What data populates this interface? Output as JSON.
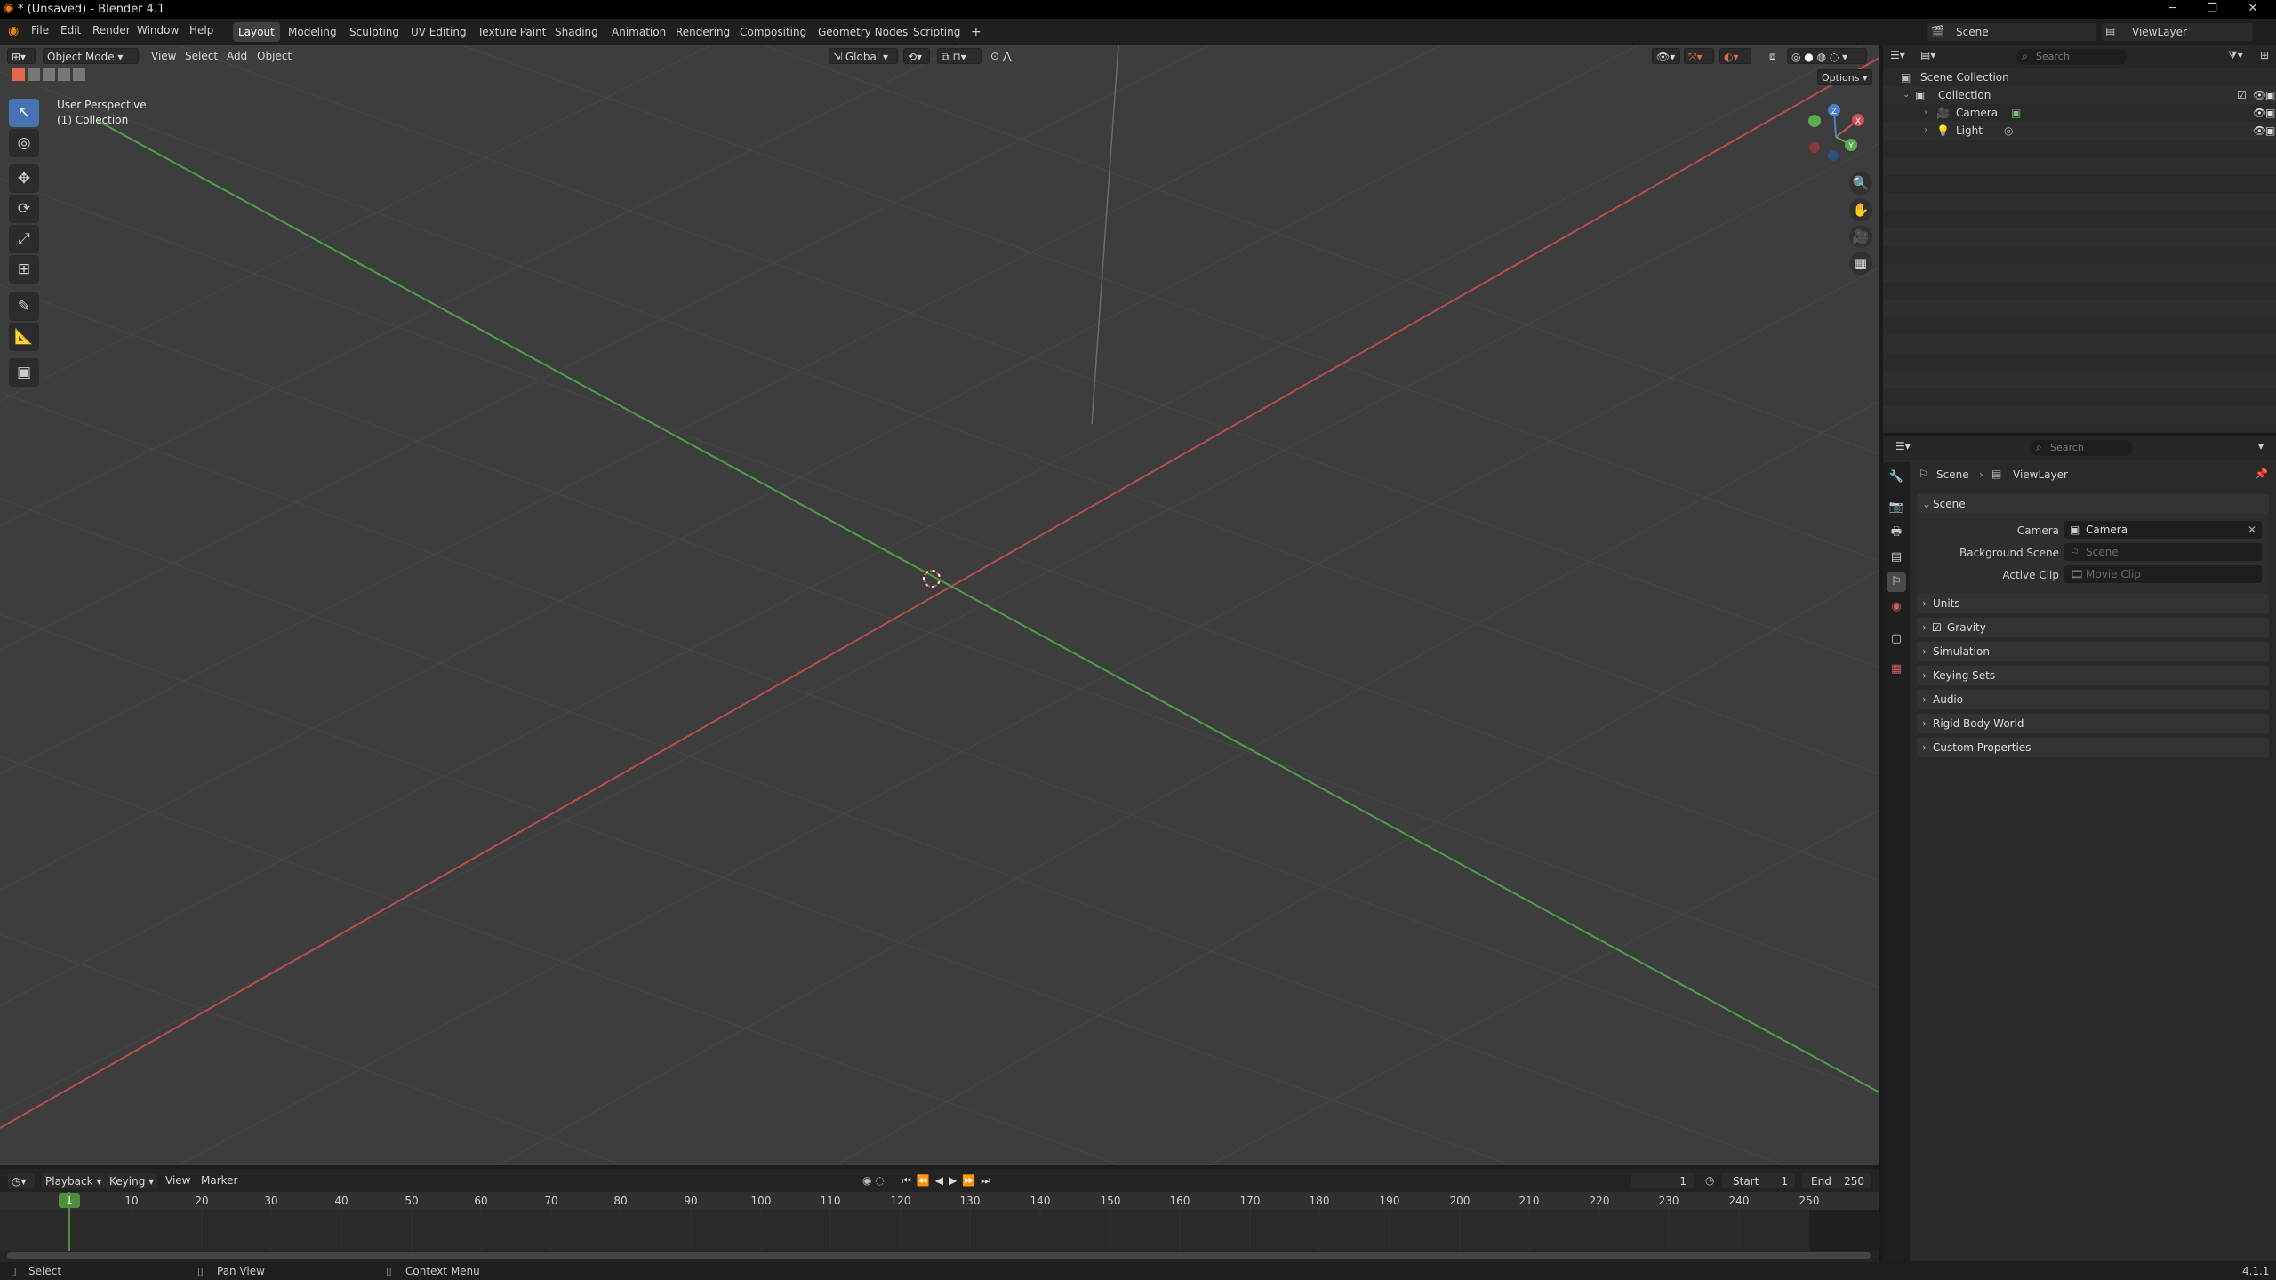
{
  "window": {
    "title": "* (Unsaved) - Blender 4.1",
    "minimize_glyph": "─",
    "maximize_glyph": "❐",
    "close_glyph": "✕"
  },
  "menu": [
    "File",
    "Edit",
    "Render",
    "Window",
    "Help"
  ],
  "workspaces": [
    "Layout",
    "Modeling",
    "Sculpting",
    "UV Editing",
    "Texture Paint",
    "Shading",
    "Animation",
    "Rendering",
    "Compositing",
    "Geometry Nodes",
    "Scripting"
  ],
  "active_workspace": "Layout",
  "add_workspace_glyph": "+",
  "scene_selector": {
    "scene": "Scene",
    "view_layer": "ViewLayer"
  },
  "viewport": {
    "mode": "Object Mode",
    "menus": [
      "View",
      "Select",
      "Add",
      "Object"
    ],
    "orientation": "Global",
    "options_label": "Options",
    "overlay_line1": "User Perspective",
    "overlay_line2": "(1) Collection",
    "tools": [
      "select-box",
      "cursor",
      "move",
      "rotate",
      "scale",
      "transform",
      "annotate",
      "measure",
      "add-cube"
    ],
    "active_tool": "select-box",
    "tool_glyphs": [
      "↖",
      "◎",
      "✥",
      "⟳",
      "⤢",
      "⊞",
      "✎",
      "📐",
      "▣"
    ],
    "nav_glyphs": [
      "🔍",
      "✋",
      "🎥",
      "▦"
    ],
    "gizmo": {
      "x": "X",
      "y": "Y",
      "z": "Z"
    },
    "colors": {
      "x_axis": "#b84d4d",
      "y_axis": "#4f9e4a",
      "grid": "#474747",
      "background": "#3d3d3d"
    }
  },
  "outliner": {
    "search_placeholder": "Search",
    "scene_collection": "Scene Collection",
    "collection": "Collection",
    "items": [
      {
        "name": "Camera",
        "type": "camera"
      },
      {
        "name": "Light",
        "type": "light"
      }
    ]
  },
  "properties": {
    "search_placeholder": "Search",
    "breadcrumb": [
      "Scene",
      "ViewLayer"
    ],
    "panel_title": "Scene",
    "fields": [
      {
        "label": "Camera",
        "value": "Camera",
        "dim": false
      },
      {
        "label": "Background Scene",
        "value": "Scene",
        "dim": true
      },
      {
        "label": "Active Clip",
        "value": "Movie Clip",
        "dim": true
      }
    ],
    "sections": [
      "Units",
      "Gravity",
      "Simulation",
      "Keying Sets",
      "Audio",
      "Rigid Body World",
      "Custom Properties"
    ],
    "gravity_checked": true
  },
  "timeline": {
    "menus": [
      "Playback",
      "Keying",
      "View",
      "Marker"
    ],
    "current_frame": "1",
    "start_label": "Start",
    "start": "1",
    "end_label": "End",
    "end": "250",
    "ruler": [
      "10",
      "20",
      "30",
      "40",
      "50",
      "60",
      "70",
      "80",
      "90",
      "100",
      "110",
      "120",
      "130",
      "140",
      "150",
      "160",
      "170",
      "180",
      "190",
      "200",
      "210",
      "220",
      "230",
      "240",
      "250"
    ],
    "playhead": "1"
  },
  "statusbar": {
    "select": "Select",
    "pan": "Pan View",
    "context": "Context Menu",
    "version": "4.1.1"
  }
}
